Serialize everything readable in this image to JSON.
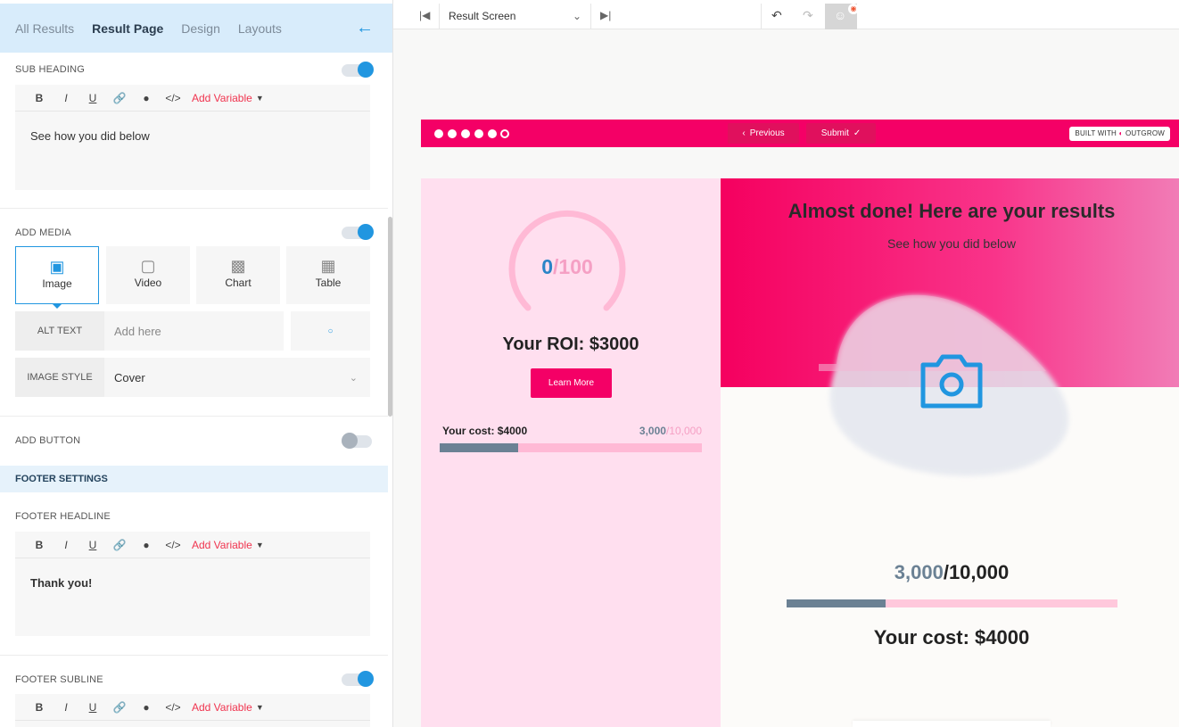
{
  "tabs": [
    "All Results",
    "Result Page",
    "Design",
    "Layouts"
  ],
  "back_icon": "arrow-left-icon",
  "sub_heading": {
    "label": "SUB HEADING",
    "text": "See how you did below",
    "toggle": "on"
  },
  "editor_toolbar": {
    "bold": "B",
    "italic": "I",
    "underline": "U",
    "add_variable": "Add Variable"
  },
  "add_media": {
    "label": "ADD MEDIA",
    "toggle": "on",
    "options": [
      "Image",
      "Video",
      "Chart",
      "Table"
    ],
    "selected": "Image"
  },
  "alt_text": {
    "label": "ALT TEXT",
    "placeholder": "Add here"
  },
  "image_style": {
    "label": "IMAGE STYLE",
    "value": "Cover"
  },
  "add_button": {
    "label": "ADD BUTTON",
    "toggle": "off"
  },
  "footer_settings": "FOOTER SETTINGS",
  "footer_headline": {
    "label": "FOOTER HEADLINE",
    "text": "Thank you!"
  },
  "footer_subline": {
    "label": "FOOTER SUBLINE",
    "toggle": "on"
  },
  "toolbar": {
    "screen_select": "Result Screen"
  },
  "preview": {
    "prev": "Previous",
    "submit": "Submit",
    "built_with": "BUILT WITH",
    "brand": "OUTGROW",
    "gauge_value": "0",
    "gauge_total": "/100",
    "roi": "Your ROI: $3000",
    "learn_more": "Learn More",
    "cost_label": "Your cost: $4000",
    "cost_value": "3,000",
    "cost_total": "/10,000",
    "cost_fraction": 0.3,
    "headline": "Almost done! Here are your results",
    "subheadline": "See how you did below",
    "big_value": "3,000",
    "big_total": "/10,000",
    "big_cost": "Your cost: $4000"
  },
  "colors": {
    "accent": "#2196e0",
    "brand_pink": "#f40066",
    "slate": "#6b8194"
  }
}
